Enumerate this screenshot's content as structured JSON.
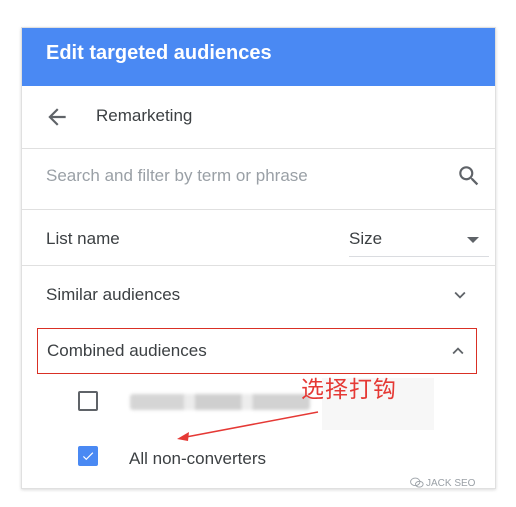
{
  "dialog": {
    "title": "Edit targeted audiences"
  },
  "nav": {
    "back_label": "Remarketing"
  },
  "search": {
    "placeholder": "Search and filter by term or phrase",
    "value": ""
  },
  "columns": {
    "list_name": "List name",
    "size_label": "Size"
  },
  "sections": {
    "similar": "Similar audiences",
    "combined": "Combined audiences"
  },
  "items": [
    {
      "label": "",
      "checked": false
    },
    {
      "label": "All non-converters",
      "checked": true
    }
  ],
  "annotation": {
    "text": "选择打钩",
    "color": "#e53935"
  },
  "watermark": {
    "text": "JACK SEO"
  },
  "colors": {
    "header_bg": "#4a89f3",
    "checkbox_checked": "#4a89f3",
    "highlight_border": "#d93025"
  }
}
